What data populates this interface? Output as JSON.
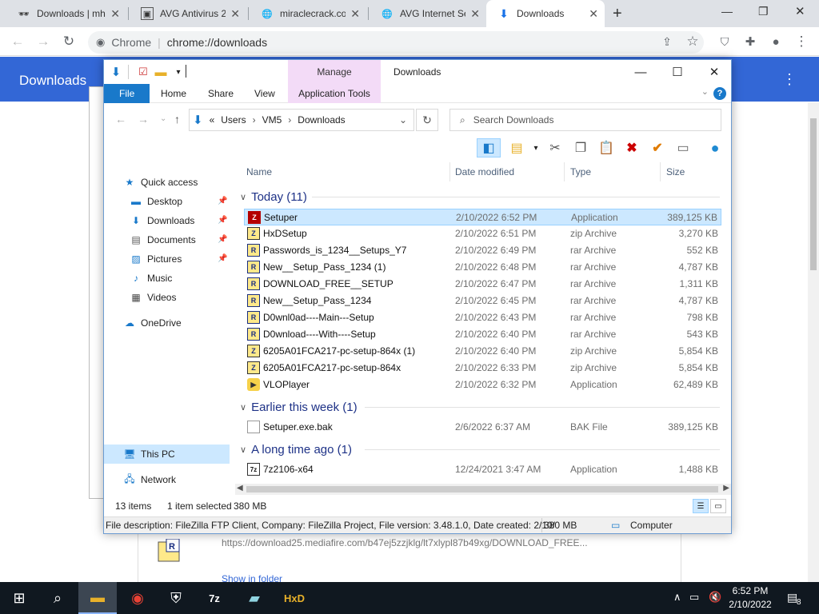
{
  "browser": {
    "tabs": [
      {
        "title": "Downloads | mh",
        "icon": "incognito-icon"
      },
      {
        "title": "AVG Antivirus 2",
        "icon": "avg-icon"
      },
      {
        "title": "miraclecrack.co",
        "icon": "globe-icon"
      },
      {
        "title": "AVG Internet Se",
        "icon": "globe-icon"
      },
      {
        "title": "Downloads",
        "icon": "download-icon",
        "active": true
      }
    ],
    "new_tab": "+",
    "chip": "Chrome",
    "url": "chrome://downloads",
    "downloads_title": "Downloads"
  },
  "download_card": {
    "url": "https://download25.mediafire.com/b47ej5zzjklg/lt7xlypl87b49xg/DOWNLOAD_FREE...",
    "show_in_folder": "Show in folder"
  },
  "explorer": {
    "manage": "Manage",
    "title": "Downloads",
    "ribbon_tabs": [
      "File",
      "Home",
      "Share",
      "View",
      "Application Tools"
    ],
    "breadcrumb": {
      "prefix": "«",
      "parts": [
        "Users",
        "VM5",
        "Downloads"
      ]
    },
    "search_placeholder": "Search Downloads",
    "nav": {
      "quick_access": "Quick access",
      "desktop": "Desktop",
      "downloads": "Downloads",
      "documents": "Documents",
      "pictures": "Pictures",
      "music": "Music",
      "videos": "Videos",
      "onedrive": "OneDrive",
      "thispc": "This PC",
      "network": "Network"
    },
    "columns": {
      "name": "Name",
      "date": "Date modified",
      "type": "Type",
      "size": "Size"
    },
    "groups": {
      "today": "Today (11)",
      "earlier": "Earlier this week (1)",
      "longago": "A long time ago (1)"
    },
    "files": [
      {
        "name": "Setuper",
        "date": "2/10/2022 6:52 PM",
        "type": "Application",
        "size": "389,125 KB",
        "icon": "filezilla-icon",
        "selected": true
      },
      {
        "name": "HxDSetup",
        "date": "2/10/2022 6:51 PM",
        "type": "zip Archive",
        "size": "3,270 KB",
        "icon": "zip-icon"
      },
      {
        "name": "Passwords_is_1234__Setups_Y7",
        "date": "2/10/2022 6:49 PM",
        "type": "rar Archive",
        "size": "552 KB",
        "icon": "rar-icon"
      },
      {
        "name": "New__Setup_Pass_1234 (1)",
        "date": "2/10/2022 6:48 PM",
        "type": "rar Archive",
        "size": "4,787 KB",
        "icon": "rar-icon"
      },
      {
        "name": "DOWNLOAD_FREE__SETUP",
        "date": "2/10/2022 6:47 PM",
        "type": "rar Archive",
        "size": "1,311 KB",
        "icon": "rar-icon"
      },
      {
        "name": "New__Setup_Pass_1234",
        "date": "2/10/2022 6:45 PM",
        "type": "rar Archive",
        "size": "4,787 KB",
        "icon": "rar-icon"
      },
      {
        "name": "D0wnl0ad----Main---Setup",
        "date": "2/10/2022 6:43 PM",
        "type": "rar Archive",
        "size": "798 KB",
        "icon": "rar-icon"
      },
      {
        "name": "D0wnload----With----Setup",
        "date": "2/10/2022 6:40 PM",
        "type": "rar Archive",
        "size": "543 KB",
        "icon": "rar-icon"
      },
      {
        "name": "6205A01FCA217-pc-setup-864x (1)",
        "date": "2/10/2022 6:40 PM",
        "type": "zip Archive",
        "size": "5,854 KB",
        "icon": "zip-icon"
      },
      {
        "name": "6205A01FCA217-pc-setup-864x",
        "date": "2/10/2022 6:33 PM",
        "type": "zip Archive",
        "size": "5,854 KB",
        "icon": "zip-icon"
      },
      {
        "name": "VLOPlayer",
        "date": "2/10/2022 6:32 PM",
        "type": "Application",
        "size": "62,489 KB",
        "icon": "vlo-icon"
      },
      {
        "name": "Setuper.exe.bak",
        "date": "2/6/2022 6:37 AM",
        "type": "BAK File",
        "size": "389,125 KB",
        "icon": "bak-icon"
      },
      {
        "name": "7z2106-x64",
        "date": "12/24/2021 3:47 AM",
        "type": "Application",
        "size": "1,488 KB",
        "icon": "7zip-icon"
      }
    ],
    "status": {
      "items": "13 items",
      "selected": "1 item selected",
      "selected_size": "380 MB"
    },
    "description": "File description: FileZilla FTP Client, Company: FileZilla Project, File version: 3.48.1.0, Date created: 2/10/",
    "desc_size": "380 MB",
    "desc_location": "Computer"
  },
  "taskbar": {
    "time": "6:52 PM",
    "date": "2/10/2022",
    "notif_count": "8"
  }
}
